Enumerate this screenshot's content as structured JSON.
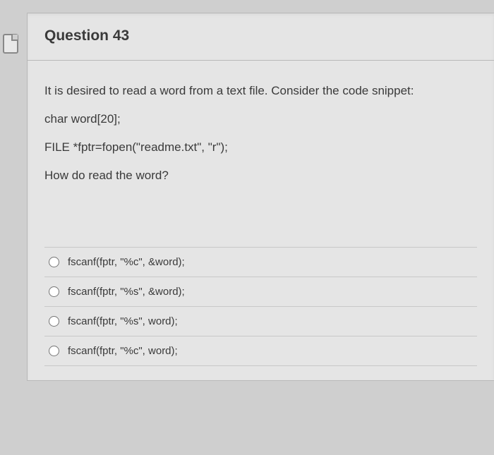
{
  "question": {
    "title": "Question 43",
    "prompt": [
      "It is desired to read a word from a text file. Consider the code snippet:",
      "char word[20];",
      "FILE *fptr=fopen(\"readme.txt\", \"r\");",
      "How do read the word?"
    ],
    "options": [
      {
        "label": "fscanf(fptr, \"%c\", &word);"
      },
      {
        "label": "fscanf(fptr, \"%s\", &word);"
      },
      {
        "label": "fscanf(fptr, \"%s\", word);"
      },
      {
        "label": "fscanf(fptr, \"%c\", word);"
      }
    ]
  }
}
